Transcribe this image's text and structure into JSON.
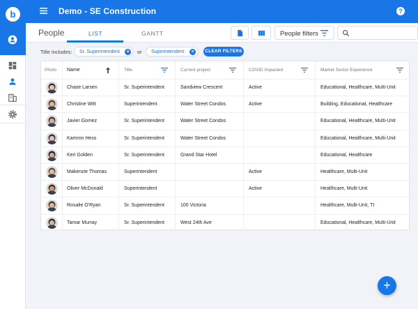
{
  "app": {
    "title": "Demo - SE Construction",
    "logo_letter": "b"
  },
  "subheader": {
    "title": "People",
    "tabs": [
      {
        "label": "LIST"
      },
      {
        "label": "GANTT"
      }
    ],
    "people_filters_label": "People filters"
  },
  "filters": {
    "label": "Title includes:",
    "chips": [
      {
        "label": "Sr. Superintendent"
      },
      {
        "label": "Superintendent"
      }
    ],
    "or_text": "or",
    "clear_label": "CLEAR FILTERS"
  },
  "table": {
    "headers": [
      "Photo",
      "Name",
      "Title",
      "Current project",
      "COVID Impacted",
      "Market Sector Experience"
    ],
    "rows": [
      {
        "name": "Chase Larsen",
        "title": "Sr. Superintendent",
        "project": "Sandview Crescent",
        "covid": "Active",
        "sectors": "Educational, Healthcare, Multi-Unit"
      },
      {
        "name": "Christine Witt",
        "title": "Superintendent",
        "project": "Water Street Condos",
        "covid": "Active",
        "sectors": "Building, Educational, Healthcare"
      },
      {
        "name": "Javier Gomez",
        "title": "Sr. Superintendent",
        "project": "Water Street Condos",
        "covid": "",
        "sectors": "Educational, Healthcare, Multi-Unit"
      },
      {
        "name": "Kamron Hess",
        "title": "Sr. Superintendent",
        "project": "Water Street Condos",
        "covid": "",
        "sectors": "Educational, Healthcare, Multi-Unit"
      },
      {
        "name": "Keri Golden",
        "title": "Sr. Superintendent",
        "project": "Grand Star Hotel",
        "covid": "",
        "sectors": "Educational, Healthcare"
      },
      {
        "name": "Makenzie Thomas",
        "title": "Superintendent",
        "project": "",
        "covid": "Active",
        "sectors": "Healthcare, Multi-Unit"
      },
      {
        "name": "Oliver McDonald",
        "title": "Superintendent",
        "project": "",
        "covid": "Active",
        "sectors": "Healthcare, Multi-Unit"
      },
      {
        "name": "Rosalie O'Ryan",
        "title": "Sr. Superintendent",
        "project": "100 Victoria",
        "covid": "",
        "sectors": "Healthcare, Multi-Unit, TI"
      },
      {
        "name": "Tamar Murray",
        "title": "Sr. Superintendent",
        "project": "West 24th Ave",
        "covid": "",
        "sectors": "Educational, Healthcare, Multi-Unit"
      }
    ]
  },
  "icons": {
    "menu": "menu-icon",
    "help": "help-icon",
    "account": "account-icon",
    "dashboard": "dashboard-icon",
    "people": "person-icon",
    "building": "building-icon",
    "settings": "gear-icon",
    "document": "document-icon",
    "columns": "columns-icon",
    "filter": "filter-icon",
    "search": "search-icon",
    "sort": "arrow-up-icon",
    "add": "plus-icon"
  },
  "colors": {
    "brand": "#1976e6",
    "background": "#f1f3f8"
  }
}
